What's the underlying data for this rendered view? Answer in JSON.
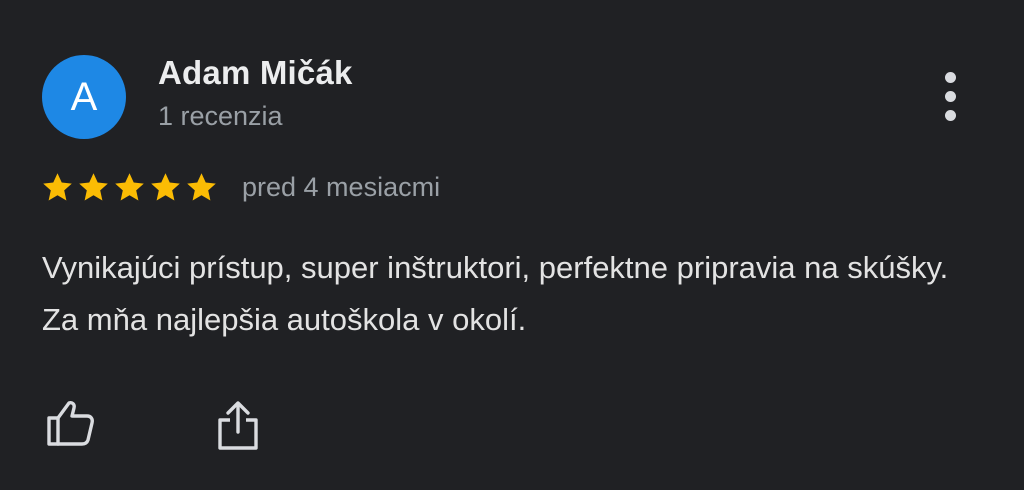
{
  "review": {
    "author": {
      "initial": "A",
      "name": "Adam Mičák",
      "review_count": "1 recenzia",
      "avatar_color": "#1E88E5"
    },
    "rating": 5,
    "rating_max": 5,
    "star_color": "#FBBC04",
    "time": "pred 4 mesiacmi",
    "text": "Vynikajúci prístup, super inštruktori, perfektne pripravia na skúšky. Za mňa najlepšia autoškola v okolí."
  },
  "icons": {
    "more": "more-vert-icon",
    "like": "thumb-up-icon",
    "share": "share-icon",
    "star": "star-icon"
  }
}
